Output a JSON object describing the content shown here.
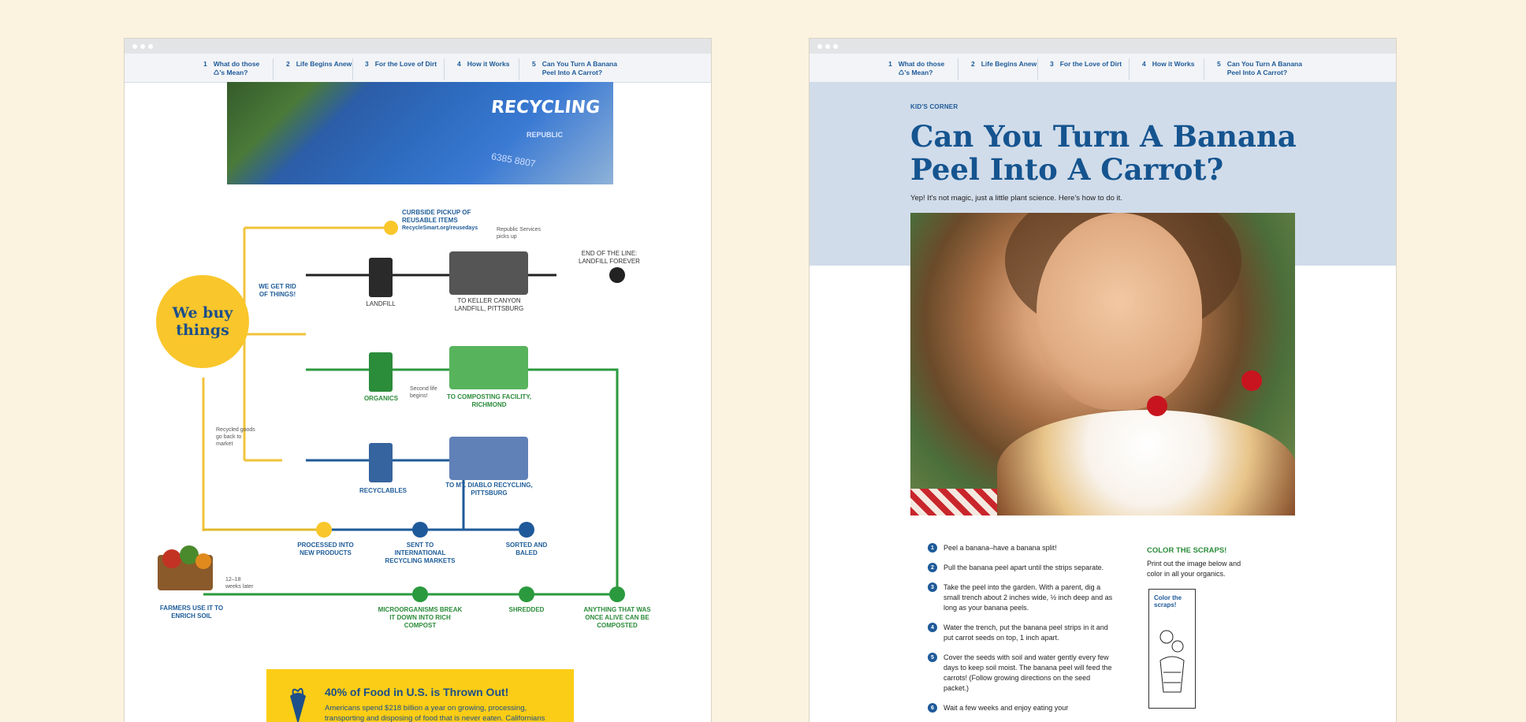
{
  "nav": [
    {
      "num": "1",
      "label": "What do those\n♺'s Mean?"
    },
    {
      "num": "2",
      "label": "Life Begins Anew"
    },
    {
      "num": "3",
      "label": "For the Love of Dirt"
    },
    {
      "num": "4",
      "label": "How it Works"
    },
    {
      "num": "5",
      "label": "Can You Turn A Banana\nPeel Into A Carrot?"
    }
  ],
  "left": {
    "hero": {
      "recycling": "RECYCLING",
      "republic": "REPUBLIC",
      "serial": "6385 8807"
    },
    "flow": {
      "we_buy": "We buy things",
      "we_get_rid": "WE GET RID OF THINGS!",
      "curbside": "CURBSIDE PICKUP OF REUSABLE ITEMS",
      "curbside_link": "RecycleSmart.org/reusedays",
      "republic_picks": "Republic Services picks up",
      "end_of_line": "END OF THE LINE: LANDFILL FOREVER",
      "landfill": "LANDFILL",
      "keller": "TO KELLER CANYON LANDFILL, PITTSBURG",
      "organics": "ORGANICS",
      "composting": "TO COMPOSTING FACILITY, RICHMOND",
      "second_life": "Second life begins!",
      "recyclables": "RECYCLABLES",
      "mt_diablo": "TO MT. DIABLO RECYCLING, PITTSBURG",
      "recycled_goods": "Recycled goods go back to market",
      "processed": "PROCESSED INTO NEW PRODUCTS",
      "international": "SENT TO INTERNATIONAL RECYCLING MARKETS",
      "sorted": "SORTED AND BALED",
      "farmers": "FARMERS USE IT TO ENRICH SOIL",
      "weeks": "12–18 weeks later",
      "micro": "MICROORGANISMS BREAK IT DOWN INTO RICH COMPOST",
      "shredded": "SHREDDED",
      "anything": "ANYTHING THAT WAS ONCE ALIVE CAN BE COMPOSTED"
    },
    "food_box": {
      "title": "40% of Food in U.S. is Thrown Out!",
      "text": "Americans spend $218 billion a year on growing, processing, transporting and disposing of food that is never eaten. Californians"
    }
  },
  "right": {
    "kicker": "KID'S CORNER",
    "title": "Can You Turn A Banana Peel Into A Carrot?",
    "subtitle": "Yep! It's not magic, just a little plant science. Here's how to do it.",
    "steps": [
      {
        "num": "1",
        "text": "Peel a banana–have a banana split!"
      },
      {
        "num": "2",
        "text": "Pull the banana peel apart until the strips separate."
      },
      {
        "num": "3",
        "text": "Take the peel into the garden. With a parent, dig a small trench about 2 inches wide, ½ inch deep and as long as your banana peels."
      },
      {
        "num": "4",
        "text": "Water the trench, put the banana peel strips in it and put carrot seeds on top, 1 inch apart."
      },
      {
        "num": "5",
        "text": "Cover the seeds with soil and water gently every few days to keep soil moist. The banana peel will feed the carrots! (Follow growing directions on the seed packet.)"
      },
      {
        "num": "6",
        "text": "Wait a few weeks and enjoy eating your"
      }
    ],
    "color_title": "COLOR THE SCRAPS!",
    "color_text": "Print out the image below and color in all your organics.",
    "scraps_label": "Color the scraps!"
  },
  "colors": {
    "brand_blue": "#1e5a99",
    "yellow": "#f9c62b",
    "green": "#2b8c3a",
    "light_blue": "#d1dcea"
  }
}
